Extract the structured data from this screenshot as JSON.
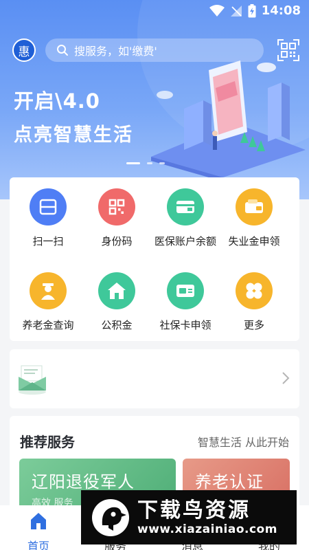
{
  "status_bar": {
    "time": "14:08"
  },
  "header": {
    "logo_glyph": "惠",
    "search_placeholder": "搜服务，如'缴费'"
  },
  "banner": {
    "line1": "开启\\4.0",
    "line2": "点亮智慧生活"
  },
  "services": [
    {
      "label": "扫一扫",
      "color": "#4f7ef5",
      "icon": "scan-icon"
    },
    {
      "label": "身份码",
      "color": "#f06a6a",
      "icon": "qrcode-icon"
    },
    {
      "label": "医保账户余额",
      "color": "#3fc89a",
      "icon": "medical-card-icon"
    },
    {
      "label": "失业金申领",
      "color": "#f7b52c",
      "icon": "wallet-icon"
    },
    {
      "label": "养老金查询",
      "color": "#f7b52c",
      "icon": "elder-icon"
    },
    {
      "label": "公积金",
      "color": "#3fc89a",
      "icon": "house-icon"
    },
    {
      "label": "社保卡申领",
      "color": "#3fc89a",
      "icon": "social-card-icon"
    },
    {
      "label": "更多",
      "color": "#f7b52c",
      "icon": "more-icon"
    }
  ],
  "recommend": {
    "title": "推荐服务",
    "subtitle": "智慧生活 从此开始",
    "tiles": [
      {
        "title": "辽阳退役军人",
        "sub": "高效 服务"
      },
      {
        "title": "养老认证",
        "sub": ""
      }
    ]
  },
  "tabbar": [
    {
      "label": "首页",
      "icon": "home-icon",
      "active": true
    },
    {
      "label": "服务",
      "icon": "service-icon",
      "active": false
    },
    {
      "label": "消息",
      "icon": "message-icon",
      "active": false
    },
    {
      "label": "我的",
      "icon": "profile-icon",
      "active": false
    }
  ],
  "watermark": {
    "text": "下载鸟资源",
    "url": "www.xiazainiao.com"
  },
  "colors": {
    "brand": "#5a8ff3",
    "active_tab": "#2f6fe0"
  }
}
